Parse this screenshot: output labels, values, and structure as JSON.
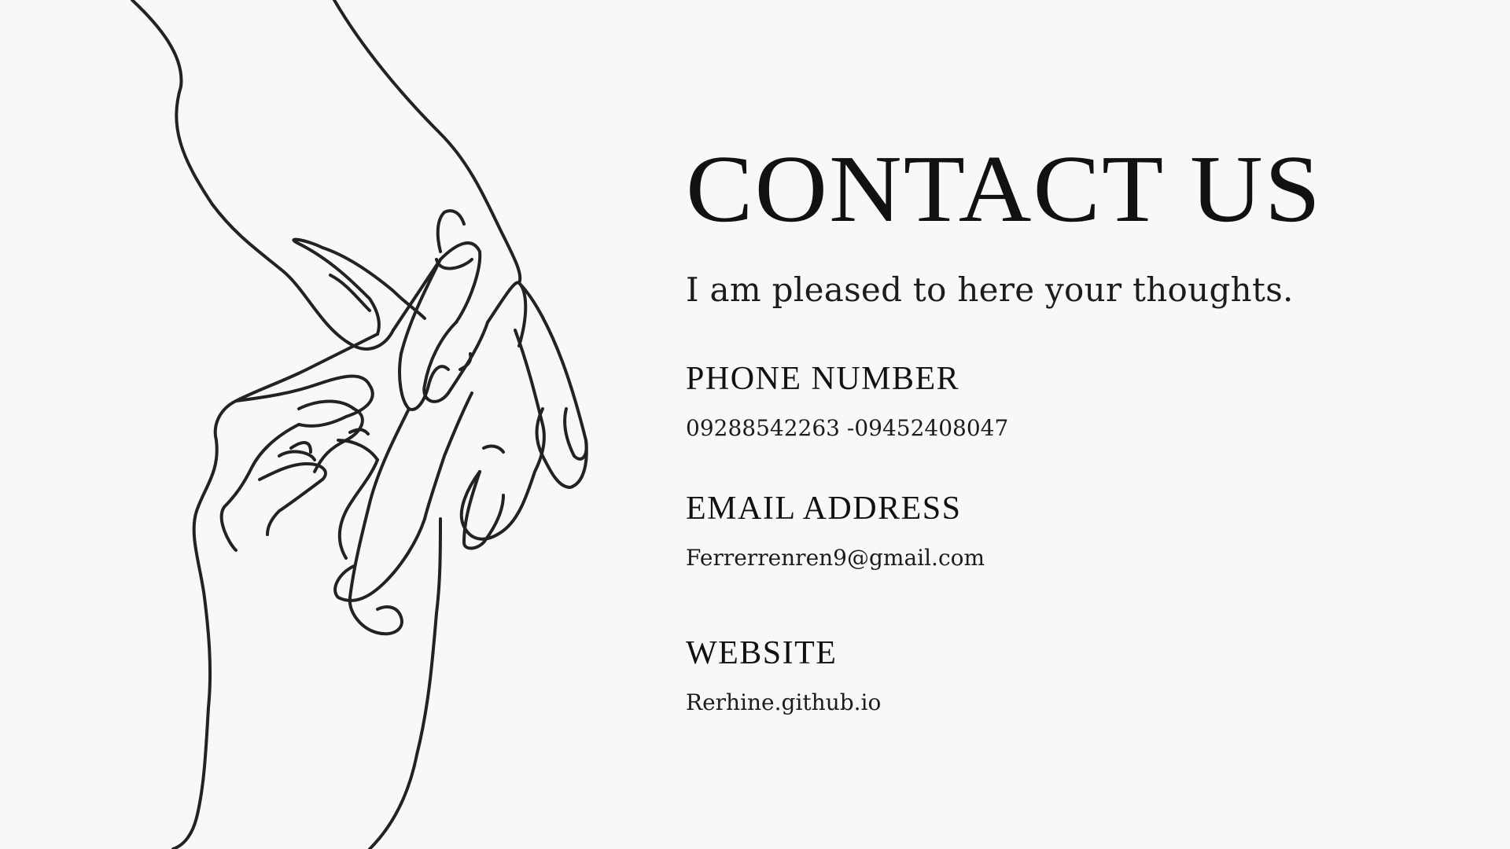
{
  "header": {
    "title": "CONTACT US",
    "subtitle": "I am pleased to here your thoughts."
  },
  "contact": {
    "phone_label": "PHONE NUMBER",
    "phone_value": "09288542263 -09452408047",
    "email_label": "EMAIL ADDRESS",
    "email_value": "Ferrerrenren9@gmail.com",
    "website_label": "WEBSITE",
    "website_value": "Rerhine.github.io"
  },
  "colors": {
    "background": "#f8f8f8",
    "text": "#111111",
    "line_art": "#222222"
  },
  "illustration": {
    "icon": "hands-line-art-icon"
  }
}
